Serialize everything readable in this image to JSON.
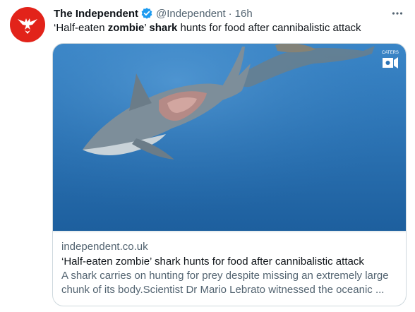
{
  "tweet": {
    "author_name": "The Independent",
    "handle": "@Independent",
    "separator": "·",
    "time": "16h",
    "text_part1": "‘Half-eaten ",
    "text_bold1": "zombie",
    "text_part2": "’ ",
    "text_bold2": "shark",
    "text_part3": " hunts for food after cannibalistic attack"
  },
  "card": {
    "domain": "independent.co.uk",
    "title": "‘Half-eaten zombie’ shark hunts for food after cannibalistic attack",
    "desc_line1": "A shark carries on hunting for prey despite missing an extremely large",
    "desc_line2": "chunk of its body.Scientist Dr Mario Lebrato witnessed the oceanic ...",
    "watermark_text": "CATERS"
  },
  "icons": {
    "avatar": "eagle-logo-icon",
    "verified": "verified-badge-icon",
    "more": "more-options-icon"
  },
  "colors": {
    "brand_red": "#e2231a",
    "verified_blue": "#1d9bf0",
    "water_top": "#3a86c8",
    "water_bottom": "#1d5f9e"
  }
}
